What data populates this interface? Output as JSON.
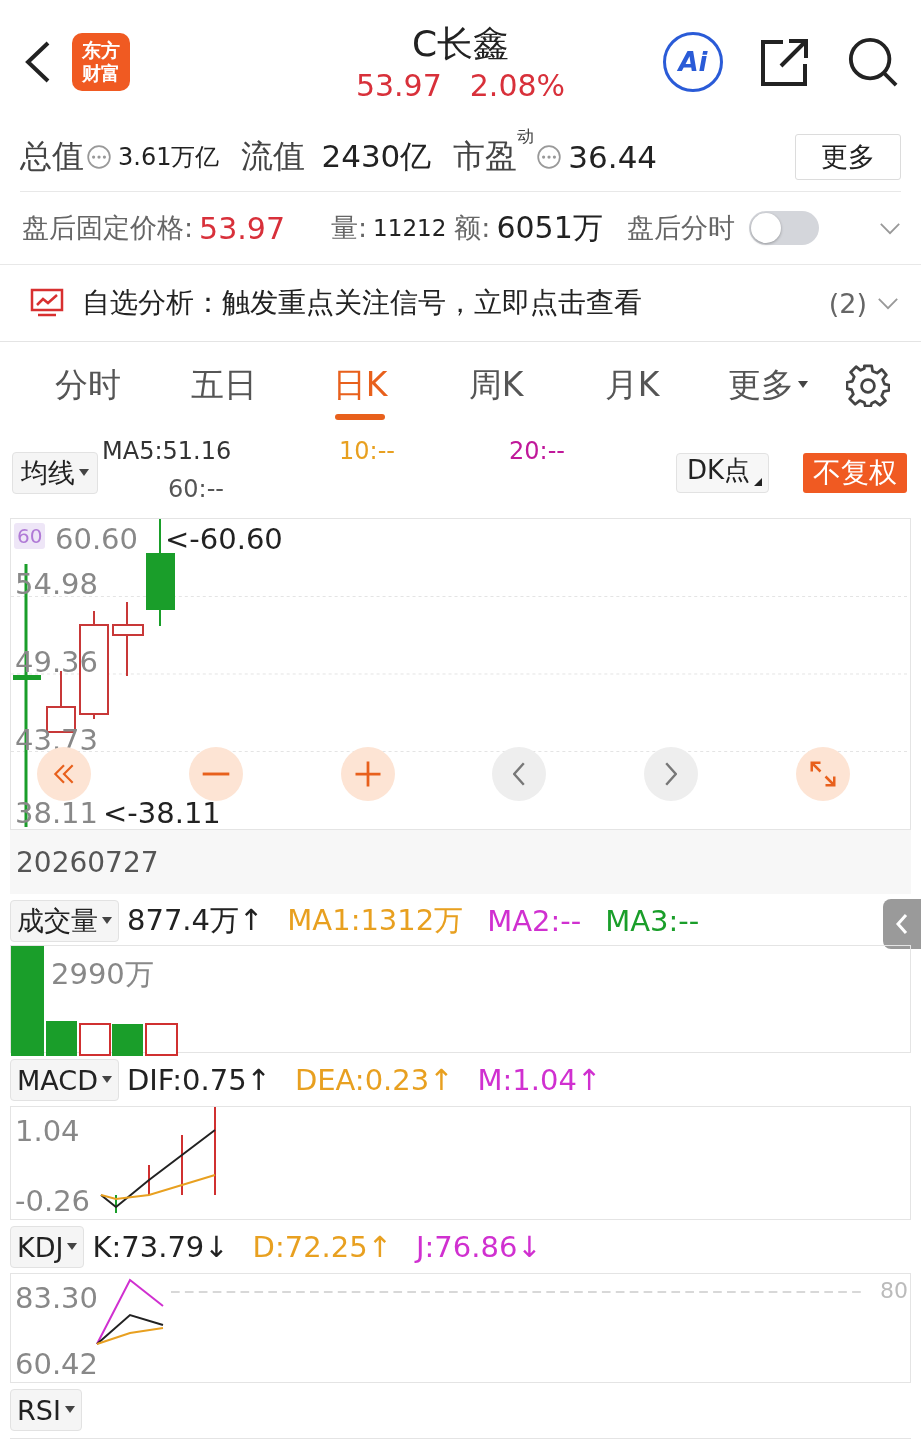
{
  "header": {
    "logo_lines": [
      "东方",
      "财富"
    ],
    "title": "C长鑫",
    "price": "53.97",
    "change": "2.08%",
    "ai_label": "Ai"
  },
  "stats": [
    {
      "label": "总值",
      "info": true,
      "value": "3.61万亿"
    },
    {
      "label": "流值",
      "info": false,
      "value": "2430亿"
    },
    {
      "label": "市盈",
      "superscript": "动",
      "info": true,
      "value": "36.44"
    }
  ],
  "more_button": "更多",
  "after_hours": {
    "label": "盘后固定价格:",
    "price": "53.97",
    "volume_label": "量:",
    "volume": "11212",
    "amount_label": "额:",
    "amount": "6051万",
    "chart_toggle_label": "盘后分时",
    "chart_toggle_on": false
  },
  "analysis": {
    "text": "自选分析：触发重点关注信号，立即点击查看",
    "count": "(2)"
  },
  "tabs": [
    {
      "label": "分时",
      "selected": false,
      "has_menu": false
    },
    {
      "label": "五日",
      "selected": false,
      "has_menu": false
    },
    {
      "label": "日K",
      "selected": true,
      "has_menu": false
    },
    {
      "label": "周K",
      "selected": false,
      "has_menu": false
    },
    {
      "label": "月K",
      "selected": false,
      "has_menu": false
    },
    {
      "label": "更多",
      "selected": false,
      "has_menu": true
    }
  ],
  "ma_bar": {
    "selector": "均线",
    "values": [
      {
        "text": "MA5:51.16",
        "color": "#333333"
      },
      {
        "text": "10:--",
        "color": "#e8a020"
      },
      {
        "text": "20:--",
        "color": "#c0189a"
      },
      {
        "text": "60:--",
        "color": "#555555"
      }
    ],
    "dk_button": "DK点",
    "adjust_button": "不复权"
  },
  "price_chart": {
    "period_badge": "60",
    "axis_labels": [
      "60.60",
      "54.98",
      "49.36",
      "43.73",
      "38.11"
    ],
    "high_marker": "<-60.60",
    "low_marker": "<-38.11",
    "date": "20260727"
  },
  "indicators": [
    {
      "kind": "volume",
      "selector": "成交量",
      "values": [
        {
          "text": "877.4万↑",
          "color": "#222222"
        },
        {
          "text": "MA1:1312万",
          "color": "#e8a020"
        },
        {
          "text": "MA2:--",
          "color": "#d030d0"
        },
        {
          "text": "MA3:--",
          "color": "#1a9e2a"
        }
      ],
      "axis_labels": [
        "2990万"
      ]
    },
    {
      "kind": "macd",
      "selector": "MACD",
      "values": [
        {
          "text": "DIF:0.75↑",
          "color": "#222222"
        },
        {
          "text": "DEA:0.23↑",
          "color": "#e8a020"
        },
        {
          "text": "M:1.04↑",
          "color": "#d030d0"
        }
      ],
      "axis_labels": [
        "1.04",
        "-0.26"
      ]
    },
    {
      "kind": "kdj",
      "selector": "KDJ",
      "values": [
        {
          "text": "K:73.79↓",
          "color": "#222222"
        },
        {
          "text": "D:72.25↑",
          "color": "#e8a020"
        },
        {
          "text": "J:76.86↓",
          "color": "#d030d0"
        }
      ],
      "axis_labels": [
        "83.30",
        "60.42"
      ],
      "reference_label": "80"
    },
    {
      "kind": "rsi",
      "selector": "RSI"
    }
  ]
}
